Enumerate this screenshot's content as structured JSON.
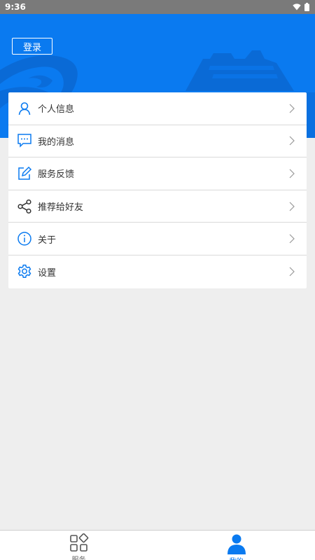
{
  "status_bar": {
    "time": "9:36"
  },
  "header": {
    "login_label": "登录"
  },
  "menu": [
    {
      "label": "个人信息",
      "icon": "user-icon"
    },
    {
      "label": "我的消息",
      "icon": "message-icon"
    },
    {
      "label": "服务反馈",
      "icon": "edit-icon"
    },
    {
      "label": "推荐给好友",
      "icon": "share-icon"
    },
    {
      "label": "关于",
      "icon": "info-icon"
    },
    {
      "label": "设置",
      "icon": "gear-icon"
    }
  ],
  "bottom_nav": [
    {
      "label": "服务",
      "icon": "services-grid-icon",
      "active": false
    },
    {
      "label": "我的",
      "icon": "person-icon",
      "active": true
    }
  ],
  "colors": {
    "accent": "#0a7af0",
    "header_bg": "#0a7af0",
    "page_bg": "#eeeeee"
  }
}
